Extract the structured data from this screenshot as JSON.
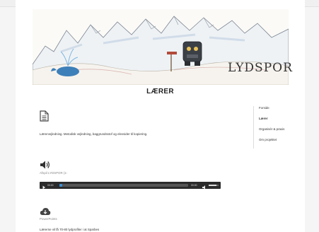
{
  "page": {
    "title": "LÆRER"
  },
  "banner": {
    "logo_text": "LYDSPOR"
  },
  "content": {
    "description": "Lærervejledning. Metodisk vejledning, baggrundsstof og elevsider til kopiering."
  },
  "sidebar": {
    "items": [
      {
        "label": "Forside"
      },
      {
        "label": "Lærer"
      },
      {
        "label": "Organisér & praxis"
      },
      {
        "label": "Om projektet"
      }
    ]
  },
  "audio": {
    "caption": "Afspil LYDSPOR (1-",
    "current_time": "00:00",
    "duration": "00:00",
    "progress": 0.02,
    "volume": 0.8
  },
  "download": {
    "caption": "PowerPoints"
  },
  "footer": {
    "text": "Lærerne vil få 70-80 lydprofiler i at Sparbes"
  },
  "colors": {
    "player_bg": "#2b2b2b",
    "progress_accent": "#3a8fd8"
  },
  "icons": {
    "document": "document-icon",
    "speaker": "speaker-icon",
    "download": "cloud-download-icon",
    "play": "play-icon",
    "mute": "volume-icon"
  }
}
